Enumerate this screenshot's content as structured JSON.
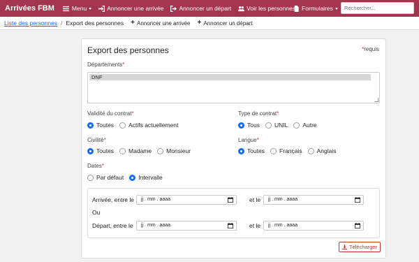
{
  "navbar": {
    "brand": "Arrivées FBM",
    "menu": "Menu",
    "arrival": "Annoncer une arrivée",
    "departure": "Annoncer un départ",
    "people": "Voir les personnes",
    "forms": "Formulaires",
    "search_placeholder": "Rechercher..."
  },
  "breadcrumb": {
    "link": "Liste des personnes",
    "separator": "/",
    "current": "Export des personnes",
    "action_arrival": "Annoncer une arrivée",
    "action_departure": "Annoncer un départ"
  },
  "form": {
    "title": "Export des personnes",
    "required_note": "requis",
    "required_mark": "*",
    "departments_label": "Départements",
    "departments_selected": "DNF",
    "validity_label": "Validité du contrat",
    "validity_options": [
      "Toutes",
      "Actifs actuellement"
    ],
    "contract_type_label": "Type de contrat",
    "contract_type_options": [
      "Tous",
      "UNIL",
      "Autre"
    ],
    "civility_label": "Civilité",
    "civility_options": [
      "Toutes",
      "Madame",
      "Monsieur"
    ],
    "language_label": "Langue",
    "language_options": [
      "Toutes",
      "Français",
      "Anglais"
    ],
    "dates_label": "Dates",
    "dates_options": [
      "Par défaut",
      "Intervalle"
    ],
    "arrival_between": "Arrivée, entre le",
    "departure_between": "Départ, entre le",
    "and": "et le",
    "or": "Ou",
    "date_placeholder": "jj . mm . aaaa",
    "download": "Télécharger"
  },
  "colors": {
    "navbar": "#a3364e",
    "accent": "#0d6efd",
    "danger": "#c0392b"
  }
}
